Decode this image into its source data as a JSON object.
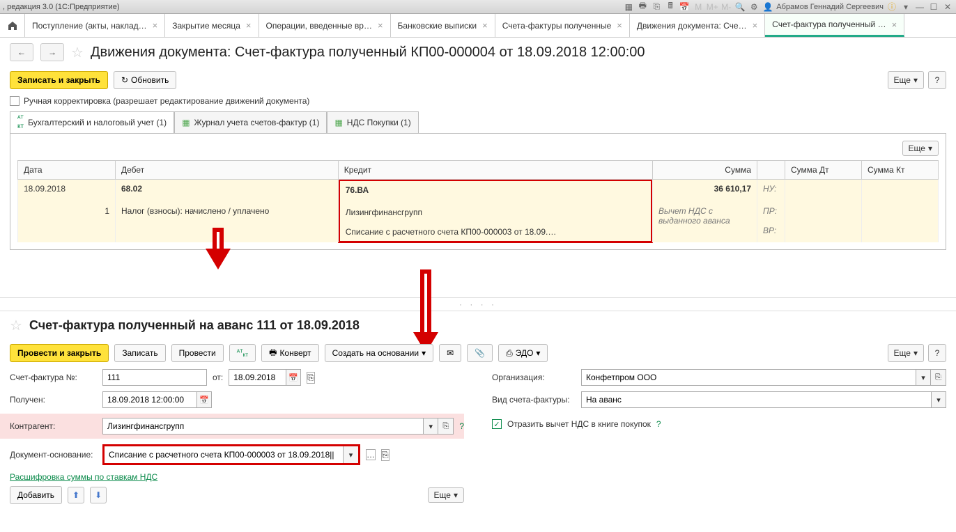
{
  "titlebar": {
    "left": ", редакция 3.0  (1С:Предприятие)",
    "user": "Абрамов Геннадий Сергеевич"
  },
  "tabs": [
    "Поступление (акты, наклад…",
    "Закрытие месяца",
    "Операции, введенные вр…",
    "Банковские выписки",
    "Счета-фактуры полученные",
    "Движения документа: Сче…",
    "Счет-фактура полученный …"
  ],
  "page1": {
    "title": "Движения документа: Счет-фактура полученный КП00-000004 от 18.09.2018 12:00:00",
    "btn_save": "Записать и закрыть",
    "btn_refresh": "Обновить",
    "eshe": "Еще",
    "chk_label": "Ручная корректировка (разрешает редактирование движений документа)",
    "subtabs": [
      "Бухгалтерский и налоговый учет (1)",
      "Журнал учета счетов-фактур (1)",
      "НДС Покупки (1)"
    ],
    "table": {
      "headers": [
        "Дата",
        "Дебет",
        "Кредит",
        "Сумма",
        "",
        "Сумма Дт",
        "Сумма Кт"
      ],
      "row": {
        "date": "18.09.2018",
        "num": "1",
        "debet_acc": "68.02",
        "debet_desc": "Налог (взносы): начислено / уплачено",
        "credit_acc": "76.ВА",
        "credit_k1": "Лизингфинансгрупп",
        "credit_k2": "Списание с расчетного счета КП00-000003 от 18.09.…",
        "sum": "36 610,17",
        "sum_desc": "Вычет НДС с выданного аванса",
        "nu": "НУ:",
        "pr": "ПР:",
        "vr": "ВР:"
      }
    }
  },
  "page2": {
    "title": "Счет-фактура полученный на аванс 111 от 18.09.2018",
    "btn_post": "Провести и закрыть",
    "btn_save": "Записать",
    "btn_post2": "Провести",
    "btn_convert": "Конверт",
    "btn_create": "Создать на основании",
    "btn_edo": "ЭДО",
    "eshe": "Еще",
    "labels": {
      "sf_no": "Счет-фактура №:",
      "ot": "от:",
      "received": "Получен:",
      "kontragent": "Контрагент:",
      "doc_basis": "Документ-основание:",
      "org": "Организация:",
      "sf_type": "Вид счета-фактуры:",
      "reflect": "Отразить вычет НДС в книге покупок"
    },
    "values": {
      "sf_no": "111",
      "date": "18.09.2018",
      "received": "18.09.2018 12:00:00",
      "kontragent": "Лизингфинансгрупп",
      "doc_basis": "Списание с расчетного счета КП00-000003 от 18.09.2018||",
      "org": "Конфетпром ООО",
      "sf_type": "На аванс"
    },
    "link": "Расшифровка суммы по ставкам НДС",
    "btn_add": "Добавить"
  }
}
